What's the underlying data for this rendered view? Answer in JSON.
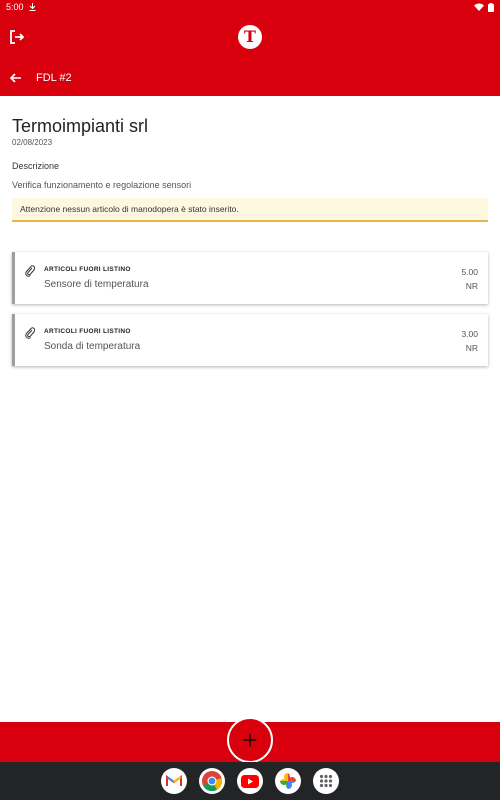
{
  "status_bar": {
    "time": "5:00"
  },
  "app_bar": {
    "logo_letter": "T"
  },
  "sub_bar": {
    "title": "FDL #2"
  },
  "header": {
    "client": "Termoimpianti srl",
    "date": "02/08/2023",
    "description_label": "Descrizione",
    "description_text": "Verifica funzionamento e regolazione sensori"
  },
  "warning": {
    "text": "Attenzione nessun articolo di manodopera è stato inserito."
  },
  "items": [
    {
      "category": "ARTICOLI FUORI LISTINO",
      "name": "Sensore di temperatura",
      "quantity": "5.00",
      "unit": "NR"
    },
    {
      "category": "ARTICOLI FUORI LISTINO",
      "name": "Sonda di temperatura",
      "quantity": "3.00",
      "unit": "NR"
    }
  ],
  "fab": {
    "symbol": "+"
  },
  "dock": [
    "gmail-icon",
    "chrome-icon",
    "youtube-icon",
    "photos-icon",
    "apps-icon"
  ],
  "colors": {
    "brand_red": "#d9000d",
    "warning_border": "#e9b64a",
    "warning_bg": "#fff8e1"
  }
}
